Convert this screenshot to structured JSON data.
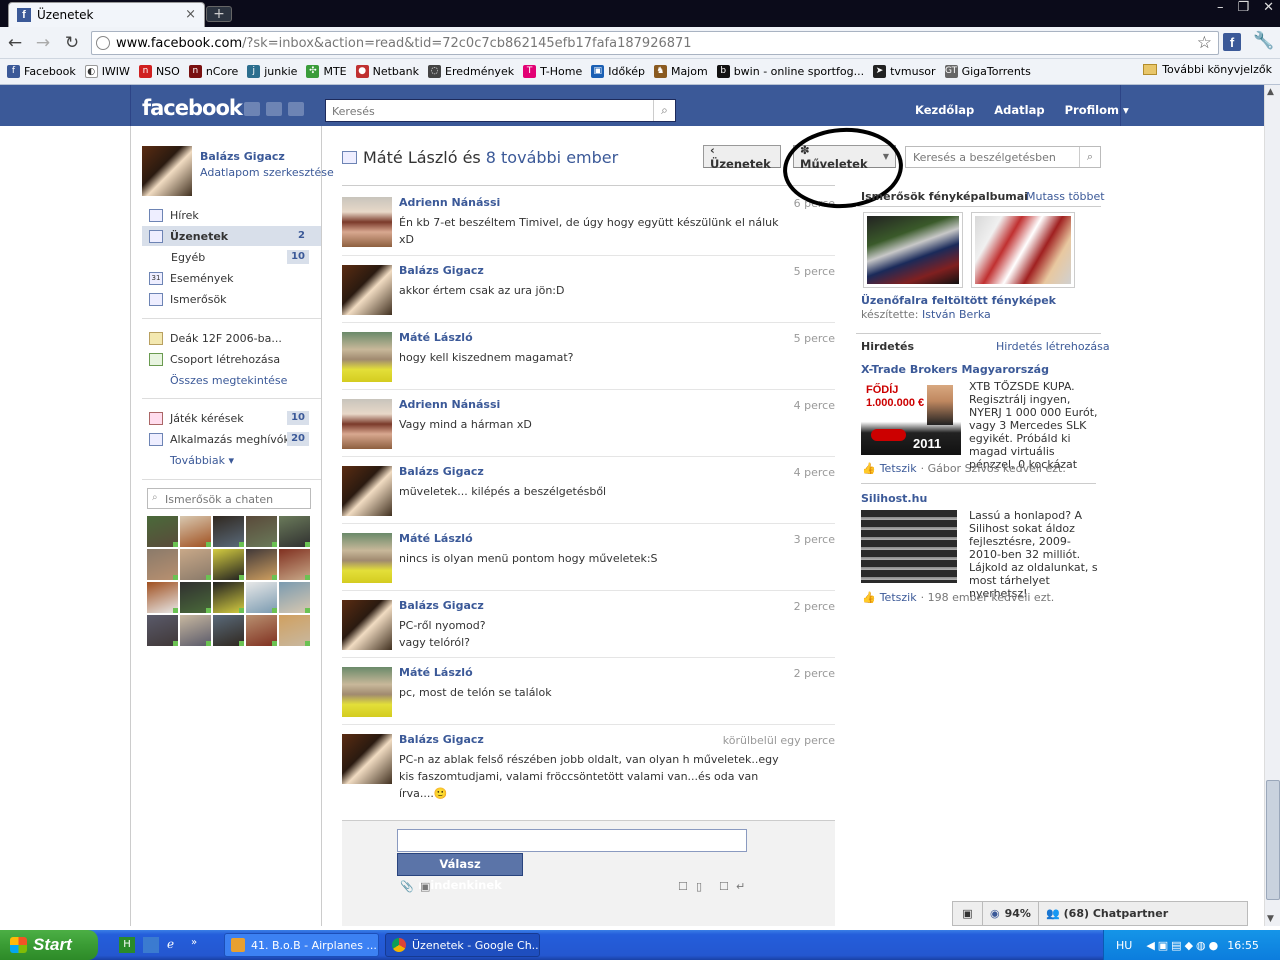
{
  "browser": {
    "tab_title": "Üzenetek",
    "tab_close": "×",
    "new_tab": "+",
    "window_buttons": [
      "–",
      "❐",
      "✕"
    ],
    "url_main": "www.facebook.com",
    "url_rest": "/?sk=inbox&action=read&tid=72c0c7cb862145efb17fafa187926871",
    "bookmarks": [
      {
        "label": "Facebook",
        "color": "#3b5998",
        "glyph": "f"
      },
      {
        "label": "IWIW",
        "color": "#ffffff",
        "glyph": "◐"
      },
      {
        "label": "NSO",
        "color": "#d02020",
        "glyph": "n"
      },
      {
        "label": "nCore",
        "color": "#7a1010",
        "glyph": "n"
      },
      {
        "label": "junkie",
        "color": "#2c6e8e",
        "glyph": "j"
      },
      {
        "label": "MTE",
        "color": "#3a9c3a",
        "glyph": "✣"
      },
      {
        "label": "Netbank",
        "color": "#c03030",
        "glyph": "●"
      },
      {
        "label": "Eredmények",
        "color": "#444444",
        "glyph": "◌"
      },
      {
        "label": "T-Home",
        "color": "#e20074",
        "glyph": "T"
      },
      {
        "label": "Időkép",
        "color": "#1a5fb4",
        "glyph": "▣"
      },
      {
        "label": "Majom",
        "color": "#8a5a20",
        "glyph": "♞"
      },
      {
        "label": "bwin - online sportfog...",
        "color": "#111111",
        "glyph": "b"
      },
      {
        "label": "tvmusor",
        "color": "#222222",
        "glyph": "➤"
      },
      {
        "label": "GigaTorrents",
        "color": "#666666",
        "glyph": "GT"
      }
    ],
    "bookmarks_more": "További könyvjelzők"
  },
  "fb_header": {
    "logo": "facebook",
    "search_placeholder": "Keresés",
    "nav": [
      "Kezdőlap",
      "Adatlap",
      "Profilom ▾"
    ]
  },
  "left": {
    "profile_name": "Balázs Gigacz",
    "profile_edit": "Adatlapom szerkesztése",
    "nav": [
      {
        "label": "Hírek",
        "count": ""
      },
      {
        "label": "Üzenetek",
        "count": "2"
      },
      {
        "label": "Egyéb",
        "count": "10"
      },
      {
        "label": "Események",
        "count": ""
      },
      {
        "label": "Ismerősök",
        "count": ""
      }
    ],
    "groups": [
      {
        "label": "Deák 12F 2006-ba...",
        "count": ""
      },
      {
        "label": "Csoport létrehozása",
        "count": ""
      }
    ],
    "see_all": "Összes megtekintése",
    "apps": [
      {
        "label": "Játék kérések",
        "count": "10"
      },
      {
        "label": "Alkalmazás meghívók",
        "count": "20"
      }
    ],
    "more": "Továbbiak ▾",
    "chat_search_placeholder": "Ismerősök a chaten",
    "event_day": "31"
  },
  "thread": {
    "title_prefix": "Máté László és",
    "title_more": "8 további ember",
    "back_button": "‹ Üzenetek",
    "actions_button": "✽ Műveletek",
    "search_placeholder": "Keresés a beszélgetésben",
    "messages": [
      {
        "name": "Adrienn Nánássi",
        "time": "6 perce",
        "text": "Én kb 7-et beszéltem Timivel, de úgy hogy együtt készülünk el náluk xD",
        "avatar": "adrienn"
      },
      {
        "name": "Balázs Gigacz",
        "time": "5 perce",
        "text": "akkor értem csak az ura jön:D",
        "avatar": "balazs"
      },
      {
        "name": "Máté László",
        "time": "5 perce",
        "text": "hogy kell kiszednem magamat?",
        "avatar": "mate"
      },
      {
        "name": "Adrienn Nánássi",
        "time": "4 perce",
        "text": "Vagy mind a hárman xD",
        "avatar": "adrienn"
      },
      {
        "name": "Balázs Gigacz",
        "time": "4 perce",
        "text": "müveletek... kilépés a beszélgetésből",
        "avatar": "balazs"
      },
      {
        "name": "Máté László",
        "time": "3 perce",
        "text": "nincs is olyan menü pontom hogy műveletek:S",
        "avatar": "mate"
      },
      {
        "name": "Balázs Gigacz",
        "time": "2 perce",
        "text": "PC-ről nyomod?\nvagy telóról?",
        "avatar": "balazs"
      },
      {
        "name": "Máté László",
        "time": "2 perce",
        "text": "pc, most de telón se találok",
        "avatar": "mate"
      },
      {
        "name": "Balázs Gigacz",
        "time": "körülbelül egy perce",
        "text": "PC-n az ablak felső részében jobb oldalt, van olyan h műveletek..egy kis faszomtudjami, valami fröccsöntetött valami van...és oda van írva....🙂",
        "avatar": "balazs"
      }
    ],
    "reply_button": "Válasz mindenkinek"
  },
  "right": {
    "albums_title": "Ismerősök fényképalbumai",
    "albums_more": "Mutass többet",
    "album_name": "Üzenőfalra feltöltött fényképek",
    "album_by_label": "készítette:",
    "album_by": "István Berka",
    "ads_title": "Hirdetés",
    "ads_create": "Hirdetés létrehozása",
    "ad1_title": "X-Trade Brokers Magyarország",
    "ad1_text": "XTB TŐZSDE KUPA. Regisztrálj ingyen, NYERJ 1 000 000 Eurót, vagy 3 Mercedes SLK egyikét. Próbáld ki magad virtuális pénzzel, 0 kockázat",
    "ad1_img_line1": "FŐDÍJ",
    "ad1_img_line2": "1.000.000 €",
    "ad1_img_year": "2011",
    "ad1_like": "Tetszik",
    "ad1_like_note": "· Gábor Szívós kedveli ezt.",
    "ad2_title": "Silihost.hu",
    "ad2_text": "Lassú a honlapod? A Silihost sokat áldoz fejlesztésre, 2009-2010-ben 32 milliót. Lájkold az oldalunkat, s most tárhelyet nyerhetsz!",
    "ad2_like": "Tetszik",
    "ad2_like_note": "· 198 ember kedveli ezt."
  },
  "chatbar": {
    "percent": "94%",
    "chat": "(68) Chatpartner"
  },
  "taskbar": {
    "start": "Start",
    "tasks": [
      "41. B.o.B - Airplanes ...",
      "Üzenetek - Google Ch..."
    ],
    "lang": "HU",
    "clock": "16:55"
  }
}
